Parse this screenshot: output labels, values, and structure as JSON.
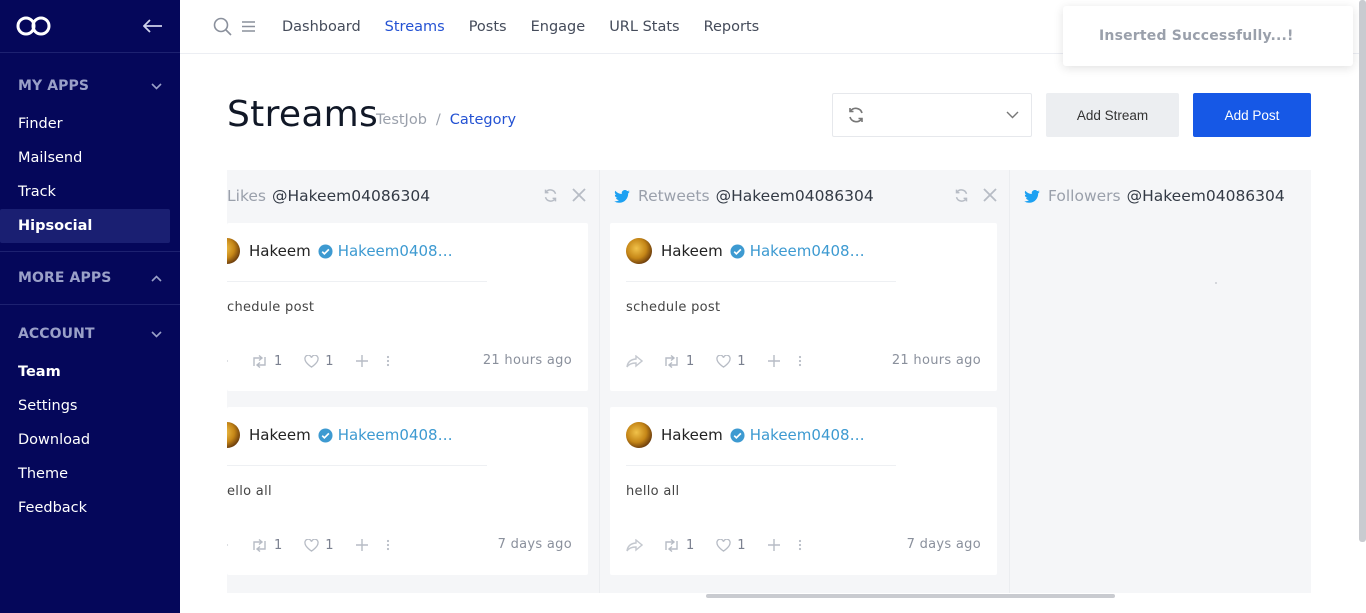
{
  "sidebar": {
    "sections": [
      {
        "title": "MY APPS",
        "expanded": true,
        "items": [
          "Finder",
          "Mailsend",
          "Track",
          "Hipsocial"
        ],
        "active": "Hipsocial"
      },
      {
        "title": "MORE APPS",
        "expanded": false,
        "items": []
      },
      {
        "title": "ACCOUNT",
        "expanded": true,
        "items": [
          "Team",
          "Settings",
          "Download",
          "Theme",
          "Feedback"
        ]
      }
    ]
  },
  "topnav": {
    "links": [
      "Dashboard",
      "Streams",
      "Posts",
      "Engage",
      "URL Stats",
      "Reports"
    ],
    "active": "Streams"
  },
  "toast": {
    "message": "Inserted Successfully...!"
  },
  "page": {
    "title": "Streams",
    "breadcrumb": [
      "TestJob",
      "Category"
    ],
    "dropdown_value": "",
    "add_stream_label": "Add Stream",
    "add_post_label": "Add Post"
  },
  "columns": [
    {
      "type": "Likes",
      "account": "@Hakeem04086304",
      "cards": [
        {
          "name": "Hakeem",
          "handle": "Hakeem0408…",
          "text": "chedule post",
          "retweets": "1",
          "likes": "1",
          "time": "21 hours ago"
        },
        {
          "name": "Hakeem",
          "handle": "Hakeem0408…",
          "text": "ello all",
          "retweets": "1",
          "likes": "1",
          "time": "7 days ago"
        }
      ]
    },
    {
      "type": "Retweets",
      "account": "@Hakeem04086304",
      "cards": [
        {
          "name": "Hakeem",
          "handle": "Hakeem0408…",
          "text": "schedule post",
          "retweets": "1",
          "likes": "1",
          "time": "21 hours ago"
        },
        {
          "name": "Hakeem",
          "handle": "Hakeem0408…",
          "text": "hello all",
          "retweets": "1",
          "likes": "1",
          "time": "7 days ago"
        }
      ]
    },
    {
      "type": "Followers",
      "account": "@Hakeem04086304",
      "cards": []
    }
  ],
  "colors": {
    "sidebar_bg": "#05075a",
    "accent": "#2452d3",
    "primary_button": "#1658e6",
    "twitter": "#1da1f2",
    "handle": "#3d9ad1"
  }
}
